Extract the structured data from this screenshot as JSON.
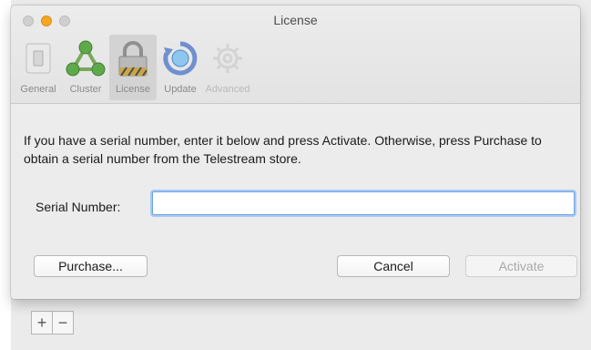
{
  "window": {
    "title": "License"
  },
  "toolbar": {
    "items": [
      {
        "label": "General",
        "icon": "switch-icon",
        "selected": false,
        "enabled": true
      },
      {
        "label": "Cluster",
        "icon": "network-triangle-icon",
        "selected": false,
        "enabled": true
      },
      {
        "label": "License",
        "icon": "padlock-icon",
        "selected": true,
        "enabled": true
      },
      {
        "label": "Update",
        "icon": "refresh-globe-icon",
        "selected": false,
        "enabled": true
      },
      {
        "label": "Advanced",
        "icon": "gear-icon",
        "selected": false,
        "enabled": false
      }
    ]
  },
  "content": {
    "message": "If you have a serial number, enter it below and press Activate. Otherwise, press Purchase to obtain a serial number from the Telestream store.",
    "serial_label": "Serial Number:",
    "serial_value": "",
    "serial_placeholder": ""
  },
  "buttons": {
    "purchase": "Purchase...",
    "cancel": "Cancel",
    "activate": "Activate"
  },
  "background": {
    "add_label": "+",
    "remove_label": "−"
  },
  "colors": {
    "minimize": "#f5a623",
    "focus_ring": "#a8c9f3",
    "selected_tab": "#d3d3d3"
  }
}
